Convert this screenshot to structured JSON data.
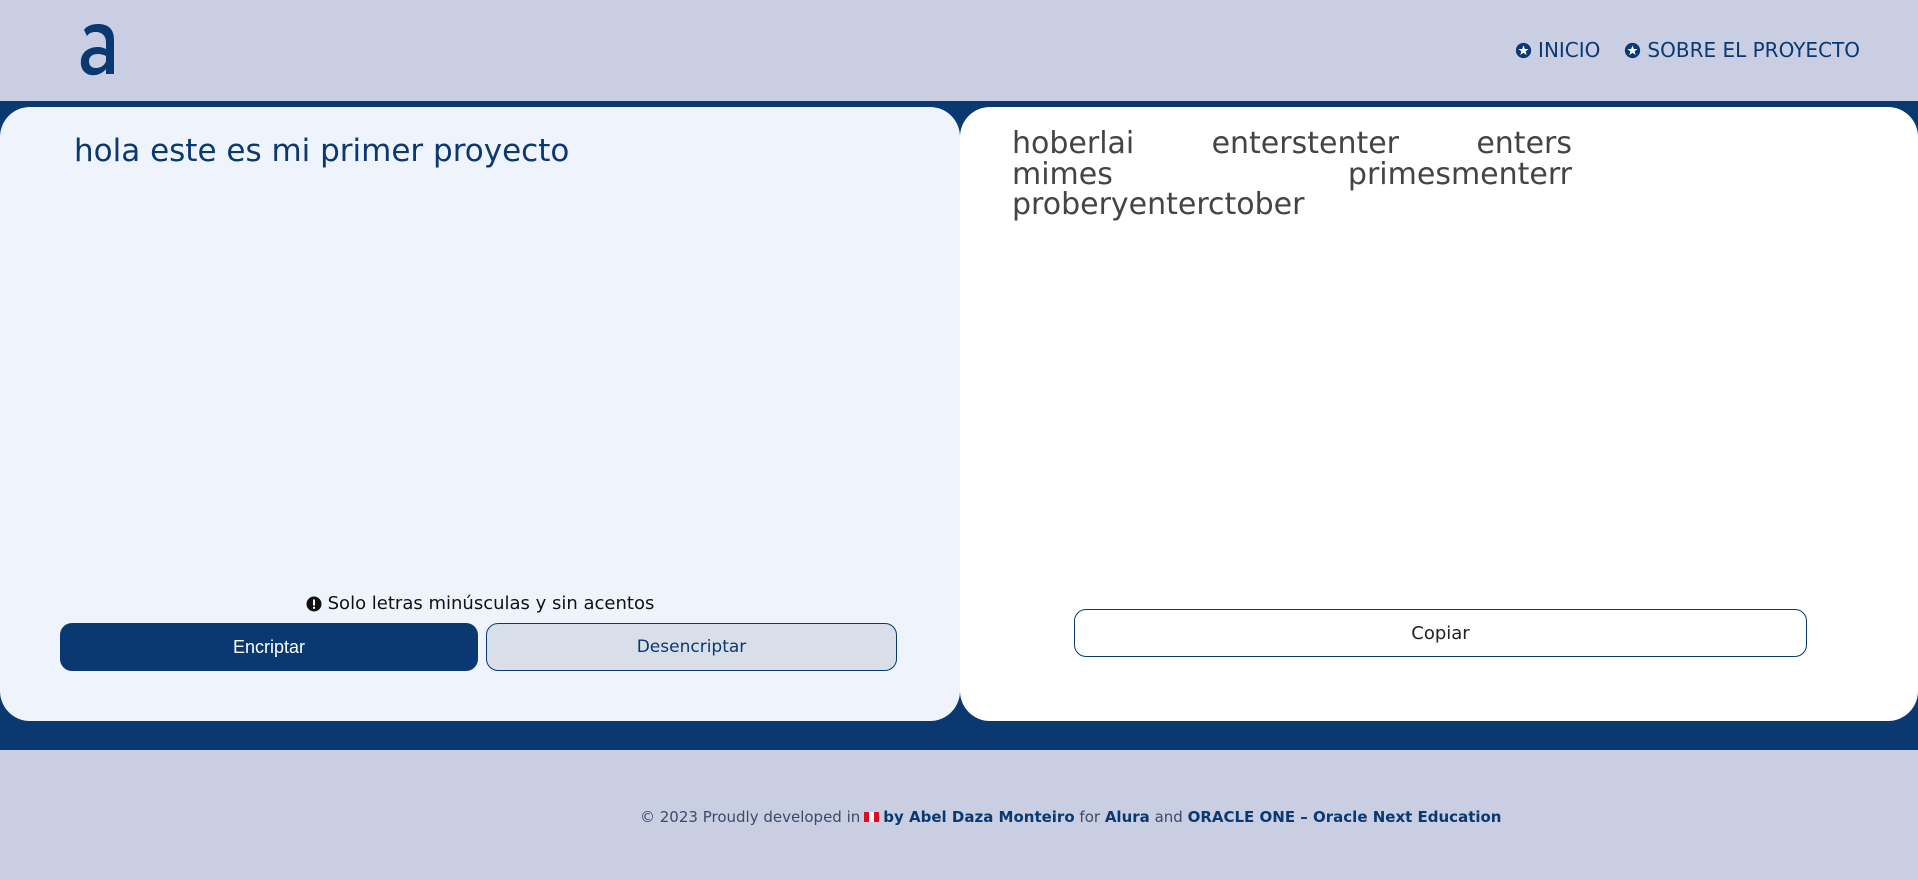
{
  "header": {
    "logo_letter": "a",
    "nav": [
      {
        "label": "INICIO",
        "icon": "star-circle-icon"
      },
      {
        "label": "SOBRE EL PROYECTO",
        "icon": "star-circle-icon"
      }
    ]
  },
  "encrypt_panel": {
    "input_value": "hola este es mi primer proyecto",
    "hint": "Solo letras minúsculas y sin acentos",
    "hint_icon": "exclamation-circle-icon",
    "encrypt_label": "Encriptar",
    "decrypt_label": "Desencriptar"
  },
  "output_panel": {
    "output_text": "hoberlai enterstenter enters mimes primesmenterr proberyenterctober",
    "copy_label": "Copiar"
  },
  "footer": {
    "prefix": "© 2023 Proudly developed in",
    "flag": "peru-flag-icon",
    "author": "by Abel Daza Monteiro",
    "for": "for",
    "alura": "Alura",
    "and": "and",
    "oracle": "ORACLE ONE – Oracle Next Education"
  },
  "colors": {
    "brand": "#0a3871",
    "background": "#c9cee3",
    "panel_left": "#eff3fc",
    "panel_right": "#ffffff"
  }
}
